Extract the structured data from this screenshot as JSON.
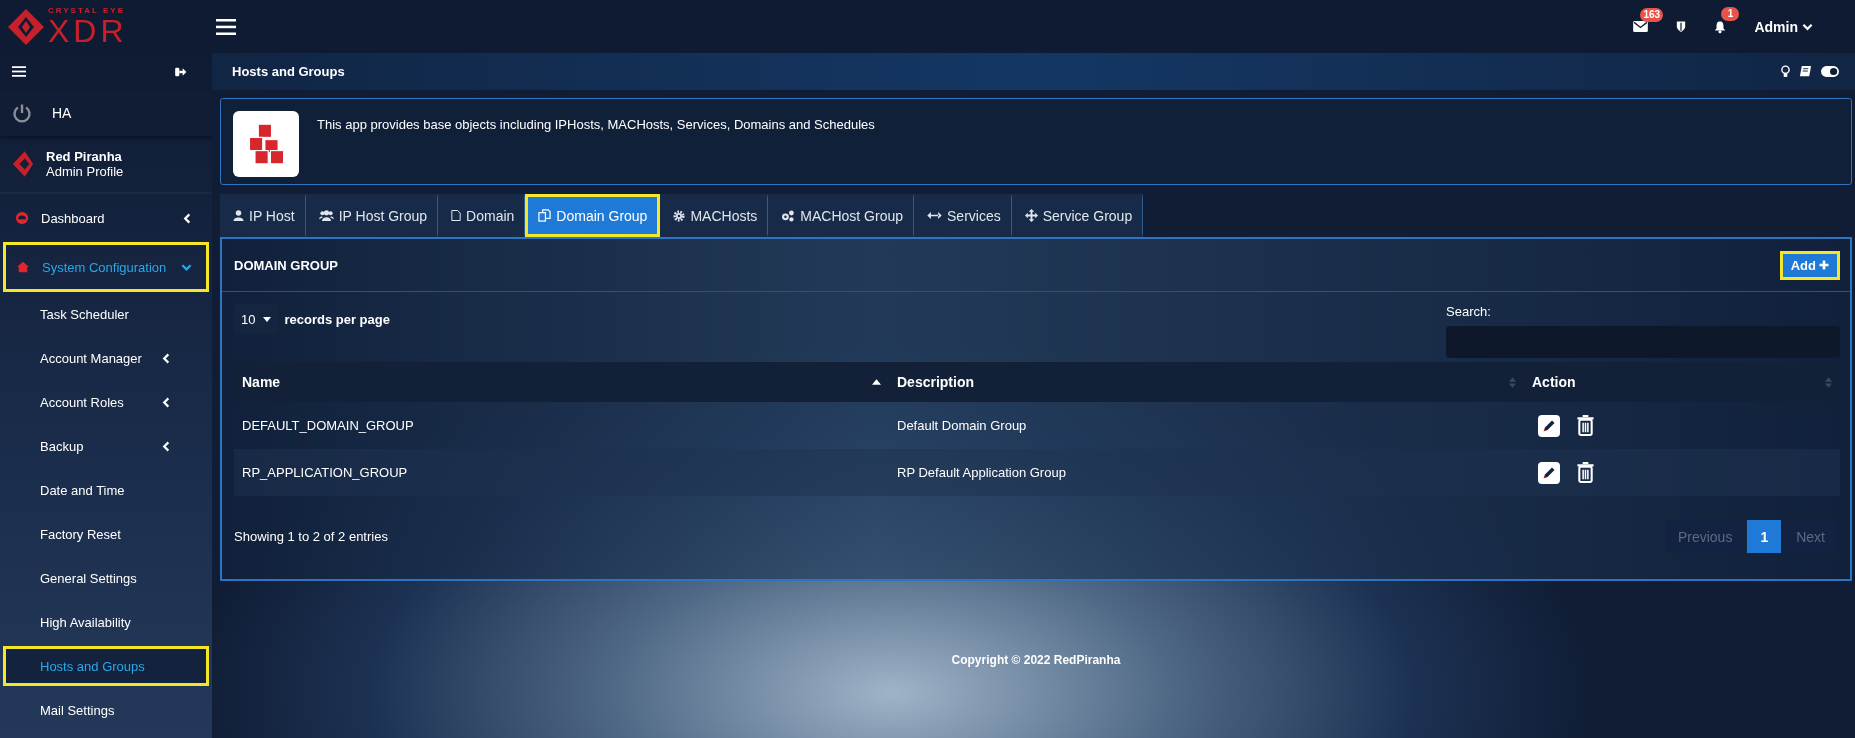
{
  "logo": {
    "tagline": "CRYSTAL EYE",
    "wordmark": "XDR"
  },
  "topbar": {
    "mail_badge": "163",
    "alerts_badge": "1",
    "user": "Admin"
  },
  "sidebar": {
    "ha_label": "HA",
    "profile": {
      "name": "Red Piranha",
      "role": "Admin Profile"
    },
    "nav": [
      {
        "label": "Dashboard",
        "kind": "menu",
        "expanded": false,
        "selected": false,
        "highlighted": false
      },
      {
        "label": "System Configuration",
        "kind": "menu",
        "expanded": true,
        "selected": true,
        "highlighted": true,
        "children": [
          {
            "label": "Task Scheduler",
            "kind": "link",
            "selected": false,
            "highlighted": false
          },
          {
            "label": "Account Manager",
            "kind": "menu",
            "selected": false,
            "highlighted": false
          },
          {
            "label": "Account Roles",
            "kind": "menu",
            "selected": false,
            "highlighted": false
          },
          {
            "label": "Backup",
            "kind": "menu",
            "selected": false,
            "highlighted": false
          },
          {
            "label": "Date and Time",
            "kind": "link",
            "selected": false,
            "highlighted": false
          },
          {
            "label": "Factory Reset",
            "kind": "link",
            "selected": false,
            "highlighted": false
          },
          {
            "label": "General Settings",
            "kind": "link",
            "selected": false,
            "highlighted": false
          },
          {
            "label": "High Availability",
            "kind": "link",
            "selected": false,
            "highlighted": false
          },
          {
            "label": "Hosts and Groups",
            "kind": "link",
            "selected": true,
            "highlighted": true
          },
          {
            "label": "Mail Settings",
            "kind": "link",
            "selected": false,
            "highlighted": false
          }
        ]
      }
    ]
  },
  "page": {
    "title": "Hosts and Groups",
    "description": "This app provides base objects including IPHosts, MACHosts, Services, Domains and Schedules"
  },
  "tabs": [
    {
      "label": "IP Host",
      "selected": false,
      "highlighted": false
    },
    {
      "label": "IP Host Group",
      "selected": false,
      "highlighted": false
    },
    {
      "label": "Domain",
      "selected": false,
      "highlighted": false
    },
    {
      "label": "Domain Group",
      "selected": true,
      "highlighted": true
    },
    {
      "label": "MACHosts",
      "selected": false,
      "highlighted": false
    },
    {
      "label": "MACHost Group",
      "selected": false,
      "highlighted": false
    },
    {
      "label": "Services",
      "selected": false,
      "highlighted": false
    },
    {
      "label": "Service Group",
      "selected": false,
      "highlighted": false
    }
  ],
  "panel": {
    "title": "DOMAIN GROUP",
    "add_button": {
      "label": "Add",
      "highlighted": true
    },
    "page_size": "10",
    "page_size_label": "records per page",
    "search_label": "Search:",
    "table": {
      "columns": [
        {
          "label": "Name",
          "sorted_ascending": true
        },
        {
          "label": "Description",
          "sorted_ascending": false
        },
        {
          "label": "Action",
          "sorted_ascending": false
        }
      ],
      "rows": [
        {
          "name": "DEFAULT_DOMAIN_GROUP",
          "description": "Default Domain Group"
        },
        {
          "name": "RP_APPLICATION_GROUP",
          "description": "RP Default Application Group"
        }
      ]
    },
    "info": "Showing 1 to 2 of 2 entries",
    "pagination": [
      {
        "label": "Previous",
        "kind": "nav",
        "disabled": true,
        "selected": false
      },
      {
        "label": "1",
        "kind": "page",
        "disabled": false,
        "selected": true
      },
      {
        "label": "Next",
        "kind": "nav",
        "disabled": true,
        "selected": false
      }
    ]
  },
  "footer": "Copyright © 2022 RedPiranha"
}
